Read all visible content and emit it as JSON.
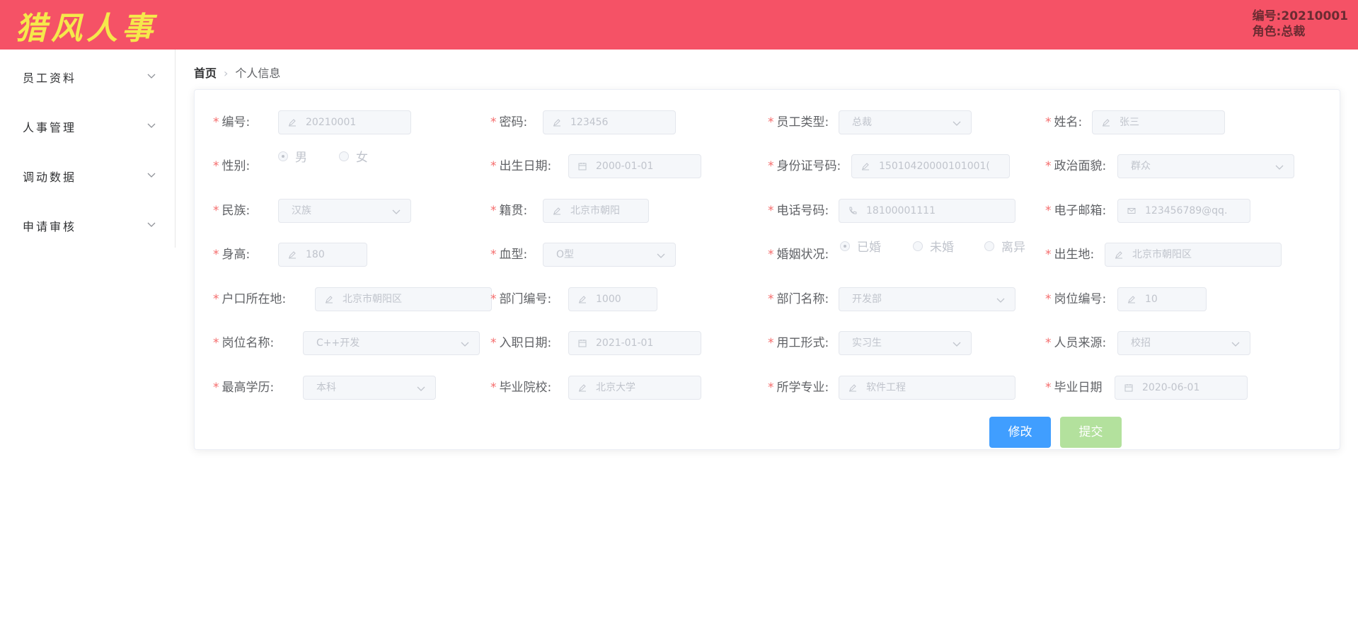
{
  "header": {
    "logo": "猎风人事",
    "user_id": "编号:20210001",
    "user_role": "角色:总裁"
  },
  "sidebar": {
    "items": [
      {
        "label": "员工资料"
      },
      {
        "label": "人事管理"
      },
      {
        "label": "调动数据"
      },
      {
        "label": "申请审核"
      }
    ]
  },
  "breadcrumb": {
    "home": "首页",
    "current": "个人信息"
  },
  "form": {
    "required_mark": "*",
    "fields": {
      "id": {
        "label": "编号:",
        "value": "20210001"
      },
      "password": {
        "label": "密码:",
        "value": "123456"
      },
      "employee_type": {
        "label": "员工类型:",
        "value": "总裁"
      },
      "name": {
        "label": "姓名:",
        "value": "张三"
      },
      "gender": {
        "label": "性别:",
        "options": [
          "男",
          "女"
        ],
        "selected": "男"
      },
      "birth_date": {
        "label": "出生日期:",
        "value": "2000-01-01"
      },
      "id_card": {
        "label": "身份证号码:",
        "value": "15010420000101001("
      },
      "political_status": {
        "label": "政治面貌:",
        "value": "群众"
      },
      "ethnicity": {
        "label": "民族:",
        "value": "汉族"
      },
      "native_place": {
        "label": "籍贯:",
        "value": "北京市朝阳"
      },
      "phone": {
        "label": "电话号码:",
        "value": "18100001111"
      },
      "email": {
        "label": "电子邮箱:",
        "value": "123456789@qq."
      },
      "height": {
        "label": "身高:",
        "value": "180"
      },
      "blood_type": {
        "label": "血型:",
        "value": "O型"
      },
      "marital_status": {
        "label": "婚姻状况:",
        "options": [
          "已婚",
          "未婚",
          "离异"
        ],
        "selected": "已婚"
      },
      "birthplace": {
        "label": "出生地:",
        "value": "北京市朝阳区"
      },
      "household": {
        "label": "户口所在地:",
        "value": "北京市朝阳区"
      },
      "dept_no": {
        "label": "部门编号:",
        "value": "1000"
      },
      "dept_name": {
        "label": "部门名称:",
        "value": "开发部"
      },
      "post_no": {
        "label": "岗位编号:",
        "value": "10"
      },
      "post_name": {
        "label": "岗位名称:",
        "value": "C++开发"
      },
      "hire_date": {
        "label": "入职日期:",
        "value": "2021-01-01"
      },
      "employment_form": {
        "label": "用工形式:",
        "value": "实习生"
      },
      "source": {
        "label": "人员来源:",
        "value": "校招"
      },
      "education": {
        "label": "最高学历:",
        "value": "本科"
      },
      "school": {
        "label": "毕业院校:",
        "value": "北京大学"
      },
      "major": {
        "label": "所学专业:",
        "value": "软件工程"
      },
      "grad_date": {
        "label": "毕业日期",
        "value": "2020-06-01"
      }
    }
  },
  "actions": {
    "edit": "修改",
    "submit": "提交"
  },
  "colors": {
    "header_bg": "#f55266",
    "logo": "#f5e84b",
    "primary": "#409eff",
    "success_disabled": "#b3e19d",
    "required": "#f56c6c"
  }
}
